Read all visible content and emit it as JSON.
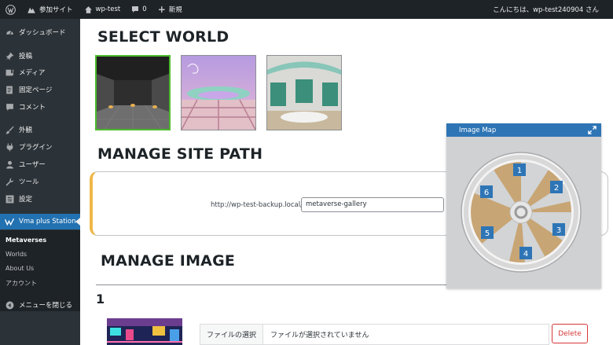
{
  "admin_bar": {
    "site_name": "参加サイト",
    "site_link": "wp-test",
    "comments_count": "0",
    "new_label": "新規",
    "greeting": "こんにちは、wp-test240904 さん"
  },
  "sidebar": {
    "items": [
      {
        "label": "ダッシュボード",
        "icon": "dashboard-icon"
      },
      {
        "label": "投稿",
        "icon": "pin-icon"
      },
      {
        "label": "メディア",
        "icon": "media-icon"
      },
      {
        "label": "固定ページ",
        "icon": "page-icon"
      },
      {
        "label": "コメント",
        "icon": "comment-icon"
      },
      {
        "label": "外観",
        "icon": "brush-icon"
      },
      {
        "label": "プラグイン",
        "icon": "plugin-icon"
      },
      {
        "label": "ユーザー",
        "icon": "user-icon"
      },
      {
        "label": "ツール",
        "icon": "wrench-icon"
      },
      {
        "label": "設定",
        "icon": "settings-icon"
      },
      {
        "label": "Vma plus Station",
        "icon": "vma-icon"
      }
    ],
    "submenu": [
      "Metaverses",
      "Worlds",
      "About Us",
      "アカウント"
    ],
    "collapse_label": "メニューを閉じる"
  },
  "content": {
    "select_world_title": "SELECT WORLD",
    "manage_path_title": "MANAGE SITE PATH",
    "path_prefix": "http://wp-test-backup.local/",
    "path_value": "metaverse-gallery",
    "manage_image_title": "MANAGE IMAGE",
    "image_index": "1",
    "file_button_label": "ファイルの選択",
    "file_status": "ファイルが選択されていません",
    "delete_label": "Delete"
  },
  "image_map": {
    "title": "Image Map",
    "markers": [
      "1",
      "2",
      "3",
      "4",
      "5",
      "6"
    ]
  },
  "colors": {
    "admin_bar": "#1d2327",
    "sidebar": "#2c3338",
    "accent": "#2271b1",
    "selected_border": "#4cbb2d",
    "notice_border": "#f0b849",
    "delete": "#d63638",
    "map_header": "#2e75b6"
  }
}
